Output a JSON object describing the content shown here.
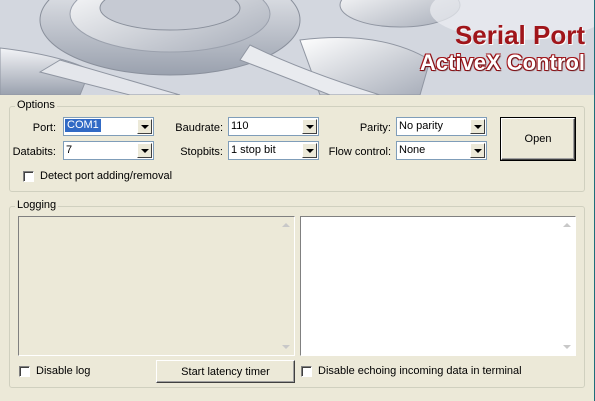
{
  "banner": {
    "title": "Serial Port",
    "subtitle": "ActiveX Control"
  },
  "options": {
    "legend": "Options",
    "port": {
      "label": "Port:",
      "value": "COM1"
    },
    "databits": {
      "label": "Databits:",
      "value": "7"
    },
    "baudrate": {
      "label": "Baudrate:",
      "value": "110"
    },
    "stopbits": {
      "label": "Stopbits:",
      "value": "1 stop bit"
    },
    "parity": {
      "label": "Parity:",
      "value": "No parity"
    },
    "flow": {
      "label": "Flow control:",
      "value": "None"
    },
    "open_button": "Open",
    "detect_label": "Detect port adding/removal"
  },
  "logging": {
    "legend": "Logging",
    "disable_log_label": "Disable log",
    "latency_button": "Start latency timer",
    "disable_echo_label": "Disable echoing incoming data in terminal"
  },
  "colors": {
    "accent": "#a0151a",
    "selection": "#316ac5",
    "window": "#ece9d8"
  }
}
